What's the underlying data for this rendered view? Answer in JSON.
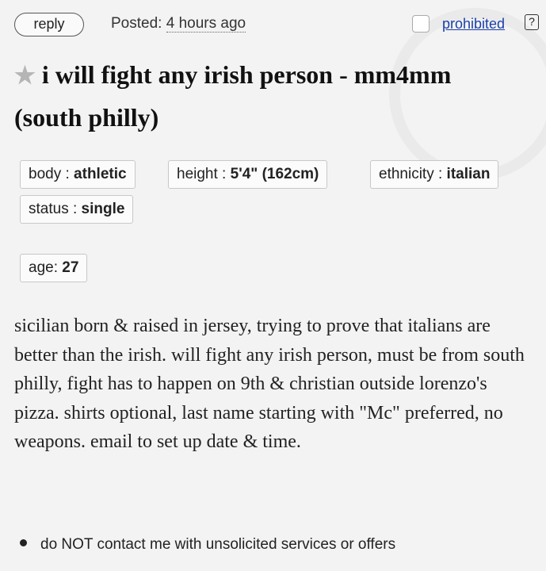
{
  "header": {
    "reply_label": "reply",
    "posted_label": "Posted:",
    "posted_time": "4 hours ago",
    "prohibited_label": "prohibited",
    "help_icon": "question-mark-icon"
  },
  "post": {
    "star_icon": "star-icon",
    "title": "i will fight any irish person - mm4mm",
    "location": "(south philly)"
  },
  "attributes": [
    {
      "key": "body",
      "value": "athletic"
    },
    {
      "key": "height",
      "value": "5'4\" (162cm)"
    },
    {
      "key": "ethnicity",
      "value": "italian"
    },
    {
      "key": "status",
      "value": "single"
    }
  ],
  "age": {
    "label": "age:",
    "value": "27"
  },
  "body_text": "sicilian born & raised in jersey, trying to prove that italians are better than the irish. will fight any irish person, must be from south philly, fight has to happen on 9th & christian outside lorenzo's pizza. shirts optional, last name starting with \"Mc\" preferred, no weapons. email to set up date & time.",
  "notices": [
    "do NOT contact me with unsolicited services or offers"
  ],
  "colors": {
    "link": "#1a3fa8",
    "background": "#f3f3f3",
    "star": "#b5b5b5"
  }
}
